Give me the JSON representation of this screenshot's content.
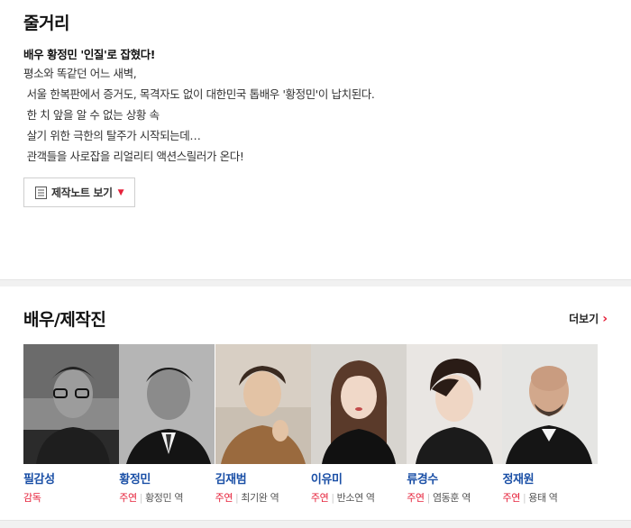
{
  "synopsis": {
    "title": "줄거리",
    "headline": "배우 황정민 '인질'로 잡혔다!",
    "lines": [
      "평소와 똑같던 어느 새벽,",
      " 서울 한복판에서 증거도, 목격자도 없이 대한민국 톱배우 '황정민'이 납치된다.",
      "",
      " 한 치 앞을 알 수 없는 상황 속",
      " 살기 위한 극한의 탈주가 시작되는데…",
      "",
      " 관객들을 사로잡을 리얼리티 액션스릴러가 온다!"
    ],
    "notes_button": "제작노트 보기"
  },
  "cast": {
    "title": "배우/제작진",
    "more_label": "더보기",
    "members": [
      {
        "name": "필감성",
        "role_type": "감독",
        "character": ""
      },
      {
        "name": "황정민",
        "role_type": "주연",
        "character": "황정민 역"
      },
      {
        "name": "김재범",
        "role_type": "주연",
        "character": "최기완 역"
      },
      {
        "name": "이유미",
        "role_type": "주연",
        "character": "반소연 역"
      },
      {
        "name": "류경수",
        "role_type": "주연",
        "character": "염동훈 역"
      },
      {
        "name": "정재원",
        "role_type": "주연",
        "character": "용태 역"
      }
    ]
  },
  "colors": {
    "accent_red": "#e6213a",
    "name_blue": "#1a4fa6"
  }
}
